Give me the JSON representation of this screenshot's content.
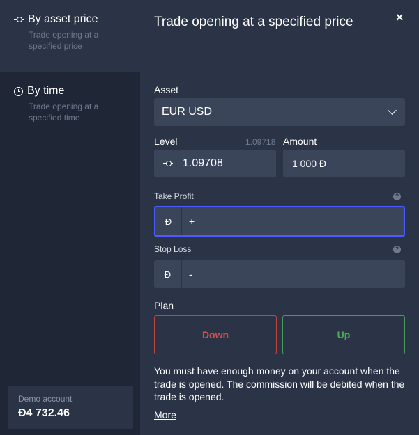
{
  "sidebar": {
    "options": [
      {
        "title": "By asset price",
        "desc": "Trade opening at a specified price",
        "icon": "price-level-icon"
      },
      {
        "title": "By time",
        "desc": "Trade opening at a specified time",
        "icon": "clock-icon"
      }
    ],
    "demo": {
      "label": "Demo account",
      "balance": "Đ4 732.46"
    }
  },
  "main": {
    "title": "Trade opening at a specified price",
    "close": "×",
    "asset": {
      "label": "Asset",
      "value": "EUR USD"
    },
    "level": {
      "label": "Level",
      "current": "1.09718",
      "value": "1.09708"
    },
    "amount": {
      "label": "Amount",
      "value": "1 000  Đ"
    },
    "take_profit": {
      "label": "Take Profit",
      "currency": "Đ",
      "sign": "+",
      "help": "?"
    },
    "stop_loss": {
      "label": "Stop Loss",
      "currency": "Đ",
      "sign": "-",
      "help": "?"
    },
    "plan": {
      "label": "Plan",
      "down": "Down",
      "up": "Up"
    },
    "note": "You must have enough money on your account when the trade is opened. The commission will be debited when the trade is opened.",
    "more": "More"
  },
  "colors": {
    "background": "#2b3446",
    "sidebar": "#1f2636",
    "field": "#3a4559",
    "focus": "#4b5bff",
    "down": "#d0514a",
    "up": "#4caf50"
  }
}
